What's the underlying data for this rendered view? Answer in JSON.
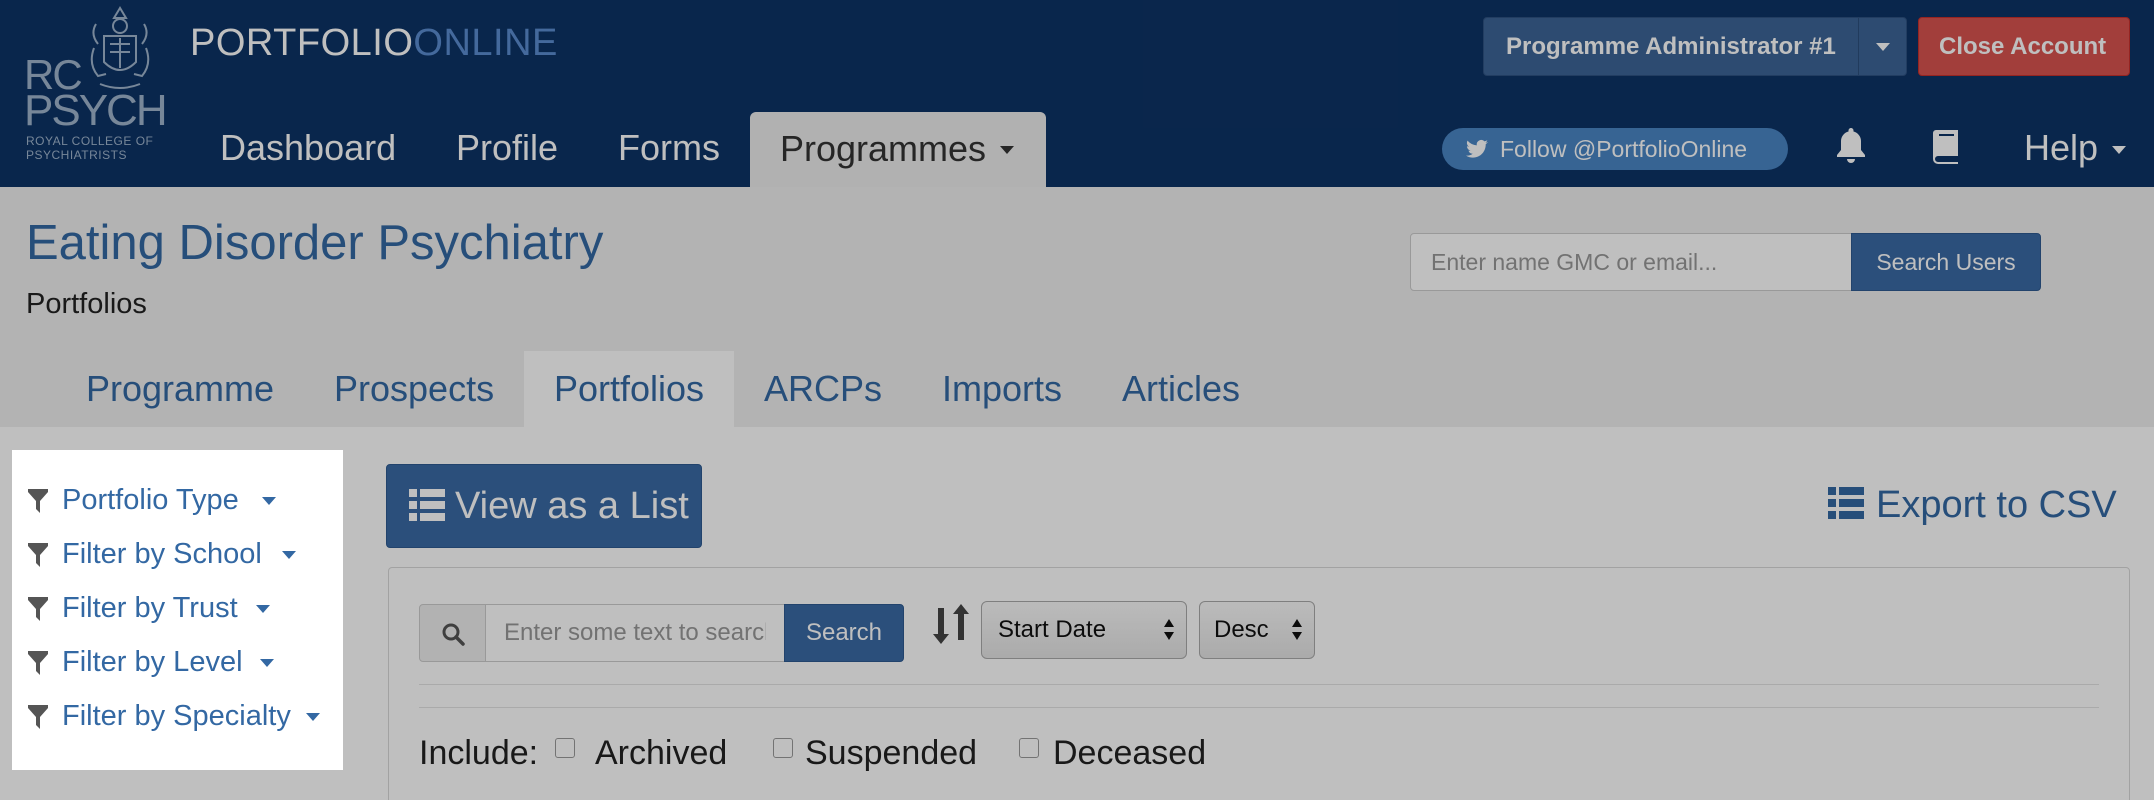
{
  "brand": {
    "logo_rc": "RC",
    "logo_psych": "PSYCH",
    "logo_sub_line1": "ROYAL COLLEGE OF",
    "logo_sub_line2": "PSYCHIATRISTS",
    "name_part1": "PORTFOLIO",
    "name_part2": "ONLINE"
  },
  "nav": {
    "items": [
      {
        "label": "Dashboard"
      },
      {
        "label": "Profile"
      },
      {
        "label": "Forms"
      },
      {
        "label": "Programmes"
      }
    ],
    "active": "Programmes",
    "user_button": "Programme Administrator #1",
    "close_button": "Close Account",
    "follow_button": "Follow @PortfolioOnline",
    "help": "Help",
    "icons": [
      "bell-icon",
      "book-icon",
      "twitter-icon"
    ]
  },
  "header": {
    "title": "Eating Disorder Psychiatry",
    "subtitle": "Portfolios",
    "search_placeholder": "Enter name GMC or email...",
    "search_button": "Search Users"
  },
  "subtabs": [
    {
      "label": "Programme"
    },
    {
      "label": "Prospects"
    },
    {
      "label": "Portfolios"
    },
    {
      "label": "ARCPs"
    },
    {
      "label": "Imports"
    },
    {
      "label": "Articles"
    }
  ],
  "active_subtab": "Portfolios",
  "filters": [
    {
      "label": "Portfolio Type"
    },
    {
      "label": "Filter by School"
    },
    {
      "label": "Filter by Trust"
    },
    {
      "label": "Filter by Level"
    },
    {
      "label": "Filter by Specialty"
    }
  ],
  "toolbar": {
    "view_list": "View as a List",
    "export": "Export to CSV"
  },
  "search": {
    "placeholder": "Enter some text to search",
    "button": "Search",
    "sort_field": "Start Date",
    "sort_order": "Desc"
  },
  "include": {
    "label": "Include:",
    "options": [
      {
        "label": "Archived",
        "checked": false
      },
      {
        "label": "Suspended",
        "checked": false
      },
      {
        "label": "Deceased",
        "checked": false
      }
    ]
  },
  "colors": {
    "navbar": "#0d3366",
    "link": "#3368a3",
    "primary_button": "#3a6aa5",
    "danger_button": "#d9534f"
  }
}
